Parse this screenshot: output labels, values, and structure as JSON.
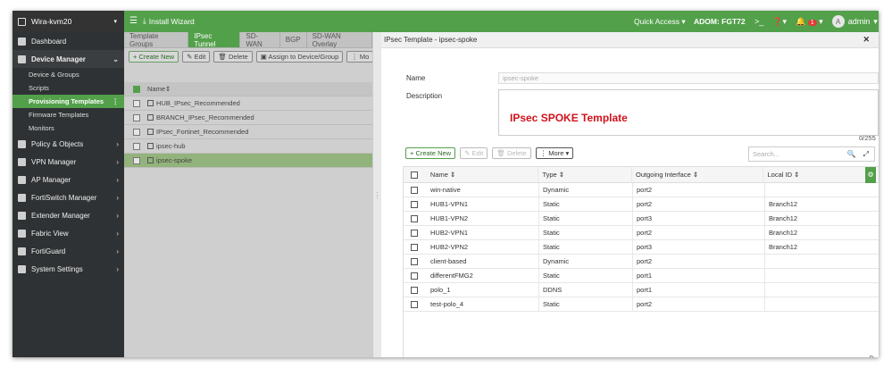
{
  "topbar": {
    "app_title": "Wira-kvm20",
    "install_wizard": "Install Wizard",
    "quick_access": "Quick Access",
    "adom": "ADOM: FGT72",
    "notifications_count": "1",
    "user_initial": "A",
    "user": "admin"
  },
  "sidebar": {
    "items": [
      {
        "label": "Dashboard"
      },
      {
        "label": "Device Manager"
      },
      {
        "label": "Policy & Objects"
      },
      {
        "label": "VPN Manager"
      },
      {
        "label": "AP Manager"
      },
      {
        "label": "FortiSwitch Manager"
      },
      {
        "label": "Extender Manager"
      },
      {
        "label": "Fabric View"
      },
      {
        "label": "FortiGuard"
      },
      {
        "label": "System Settings"
      }
    ],
    "device_manager_sub": [
      {
        "label": "Device & Groups"
      },
      {
        "label": "Scripts"
      },
      {
        "label": "Provisioning Templates"
      },
      {
        "label": "Firmware Templates"
      },
      {
        "label": "Monitors"
      }
    ]
  },
  "content": {
    "tabs": [
      "Template Groups",
      "IPsec Tunnel",
      "SD-WAN",
      "BGP",
      "SD-WAN Overlay"
    ],
    "toolbar": {
      "create_new": "Create New",
      "edit": "Edit",
      "delete": "Delete",
      "assign": "Assign to Device/Group",
      "more": "Mo"
    },
    "list_header": "Name",
    "templates": [
      "HUB_IPsec_Recommended",
      "BRANCH_IPsec_Recommended",
      "IPsec_Fortinet_Recommended",
      "ipsec-hub",
      "ipsec-spoke"
    ]
  },
  "panel": {
    "title": "IPsec Template - ipsec-spoke",
    "name_label": "Name",
    "name_value": "ipsec-spoke",
    "description_label": "Description",
    "description_value": "IPsec SPOKE Template",
    "char_counter": "0/255",
    "toolbar": {
      "create_new": "Create New",
      "edit": "Edit",
      "delete": "Delete",
      "more": "More"
    },
    "search_placeholder": "Search...",
    "columns": [
      "Name",
      "Type",
      "Outgoing Interface",
      "Local ID"
    ],
    "rows": [
      {
        "name": "win-native",
        "type": "Dynamic",
        "iface": "port2",
        "local_id": ""
      },
      {
        "name": "HUB1-VPN1",
        "type": "Static",
        "iface": "port2",
        "local_id": "Branch12"
      },
      {
        "name": "HUB1-VPN2",
        "type": "Static",
        "iface": "port3",
        "local_id": "Branch12"
      },
      {
        "name": "HUB2-VPN1",
        "type": "Static",
        "iface": "port2",
        "local_id": "Branch12"
      },
      {
        "name": "HUB2-VPN2",
        "type": "Static",
        "iface": "port3",
        "local_id": "Branch12"
      },
      {
        "name": "client-based",
        "type": "Dynamic",
        "iface": "port2",
        "local_id": ""
      },
      {
        "name": "differentFMG2",
        "type": "Static",
        "iface": "port1",
        "local_id": ""
      },
      {
        "name": "polo_1",
        "type": "DDNS",
        "iface": "port1",
        "local_id": ""
      },
      {
        "name": "test-polo_4",
        "type": "Static",
        "iface": "port2",
        "local_id": ""
      }
    ],
    "total": "9"
  },
  "colors": {
    "accent": "#53a04b",
    "sidebar_bg": "#2f3234",
    "description_text": "#d0121b"
  }
}
